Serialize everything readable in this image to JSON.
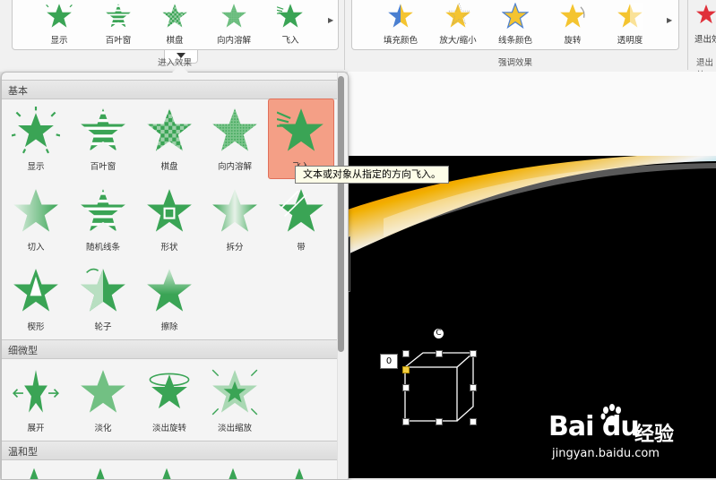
{
  "ribbon": {
    "entrance_group": {
      "label": "进入效果",
      "items": [
        {
          "label": "显示",
          "icon": "star-appear-icon"
        },
        {
          "label": "百叶窗",
          "icon": "star-blinds-icon"
        },
        {
          "label": "棋盘",
          "icon": "star-checkerboard-icon"
        },
        {
          "label": "向内溶解",
          "icon": "star-dissolve-in-icon"
        },
        {
          "label": "飞入",
          "icon": "star-fly-in-icon"
        }
      ]
    },
    "emphasis_group": {
      "label": "强调效果",
      "items": [
        {
          "label": "填充颜色",
          "icon": "star-fill-color-icon"
        },
        {
          "label": "放大/缩小",
          "icon": "star-grow-shrink-icon"
        },
        {
          "label": "线条颜色",
          "icon": "star-line-color-icon"
        },
        {
          "label": "旋转",
          "icon": "star-spin-icon"
        },
        {
          "label": "透明度",
          "icon": "star-transparency-icon"
        }
      ]
    },
    "exit_group": {
      "label": "退出效",
      "item_label": "退出效"
    }
  },
  "panel": {
    "sections": [
      {
        "title": "基本",
        "effects": [
          "显示",
          "百叶窗",
          "棋盘",
          "向内溶解",
          "飞入",
          "切入",
          "随机线条",
          "形状",
          "拆分",
          "带",
          "楔形",
          "轮子",
          "擦除"
        ]
      },
      {
        "title": "细微型",
        "effects": [
          "展开",
          "淡化",
          "淡出旋转",
          "淡出缩放"
        ]
      },
      {
        "title": "温和型",
        "effects": []
      }
    ],
    "selected_effect": "飞入",
    "tooltip": "文本或对象从指定的方向飞入。"
  },
  "slide": {
    "animation_order": "0",
    "rotate_glyph": "C"
  },
  "watermark": {
    "brand": "Bai du",
    "product": "经验",
    "url": "jingyan.baidu.com"
  },
  "colors": {
    "star_green": "#3aa455",
    "selected_bg": "#f49f86",
    "emphasis_blue": "#4a7fd0",
    "emphasis_gold": "#f4c430",
    "exit_red": "#e0303a"
  }
}
